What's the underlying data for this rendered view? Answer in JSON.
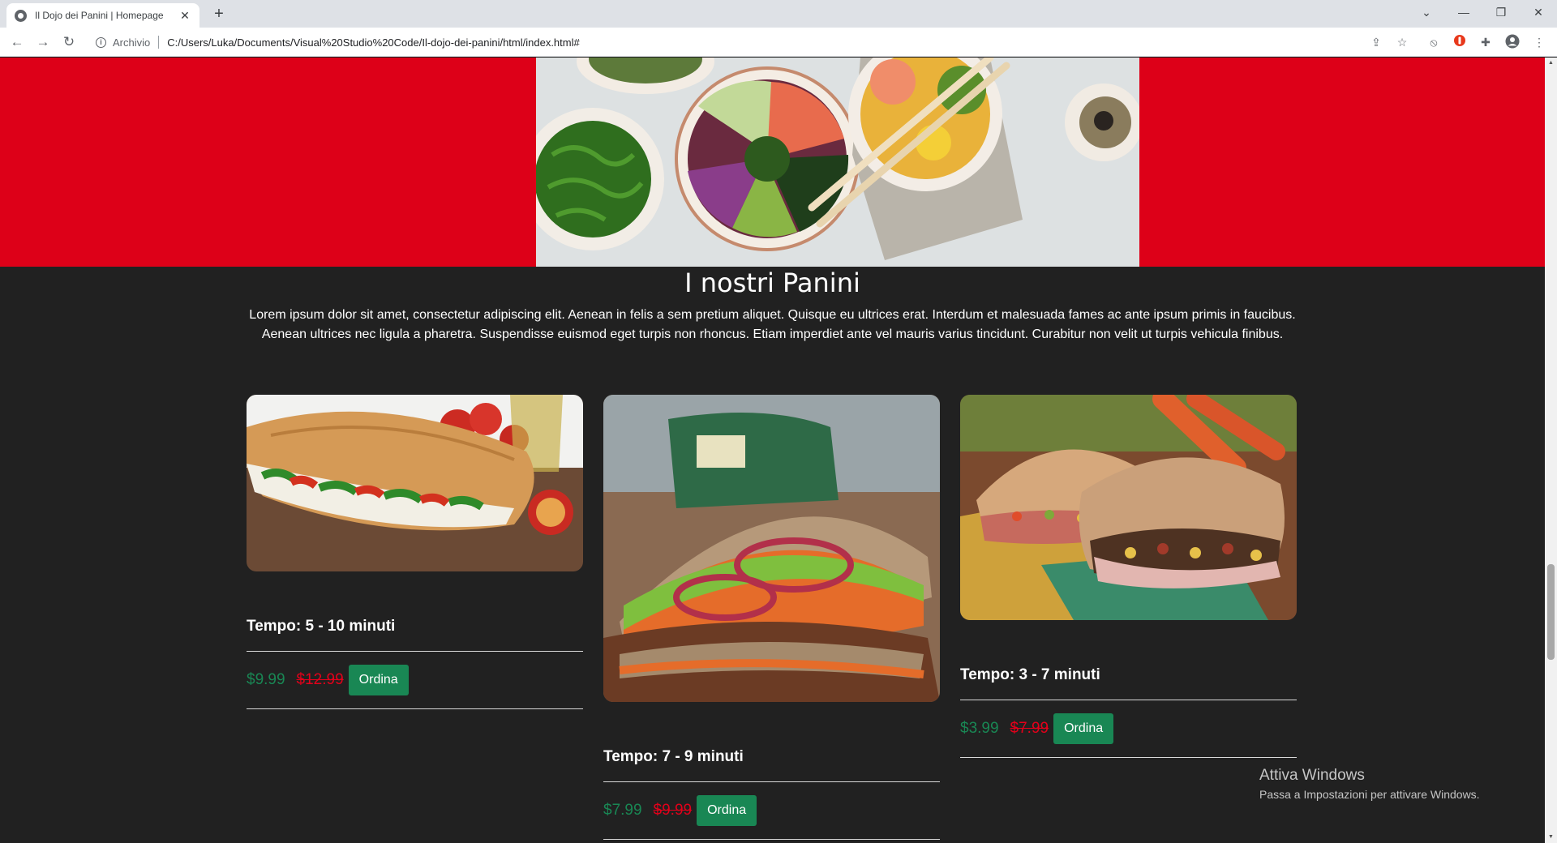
{
  "browser": {
    "tab_title": "Il Dojo dei Panini | Homepage",
    "tab_close": "✕",
    "new_tab": "+",
    "address_scheme": "Archivio",
    "address_url": "C:/Users/Luka/Documents/Visual%20Studio%20Code/Il-dojo-dei-panini/html/index.html#",
    "icons": [
      "back-icon",
      "forward-icon",
      "reload-icon",
      "info-icon",
      "share-icon",
      "star-icon",
      "block-icon",
      "extension-red-icon",
      "puzzle-icon",
      "profile-icon",
      "menu-icon"
    ]
  },
  "section": {
    "title": "I nostri Panini",
    "text": "Lorem ipsum dolor sit amet, consectetur adipiscing elit. Aenean in felis a sem pretium aliquet. Quisque eu ultrices erat. Interdum et malesuada fames ac ante ipsum primis in faucibus. Aenean ultrices nec ligula a pharetra. Suspendisse euismod eget turpis non rhoncus. Etiam imperdiet ante vel mauris varius tincidunt. Curabitur non velit ut turpis vehicula finibus."
  },
  "cards": [
    {
      "time": "Tempo: 5 - 10 minuti",
      "price": "$9.99",
      "old_price": "$12.99",
      "button": "Ordina"
    },
    {
      "time": "Tempo: 7 - 9 minuti",
      "price": "$7.99",
      "old_price": "$9.99",
      "button": "Ordina"
    },
    {
      "time": "Tempo: 3 - 7 minuti",
      "price": "$3.99",
      "old_price": "$7.99",
      "button": "Ordina"
    }
  ],
  "watermark": {
    "title": "Attiva Windows",
    "subtitle": "Passa a Impostazioni per attivare Windows."
  },
  "colors": {
    "hero_red": "#dd0018",
    "page_bg": "#212121",
    "price_green": "#198754",
    "price_red": "#e3001a"
  }
}
